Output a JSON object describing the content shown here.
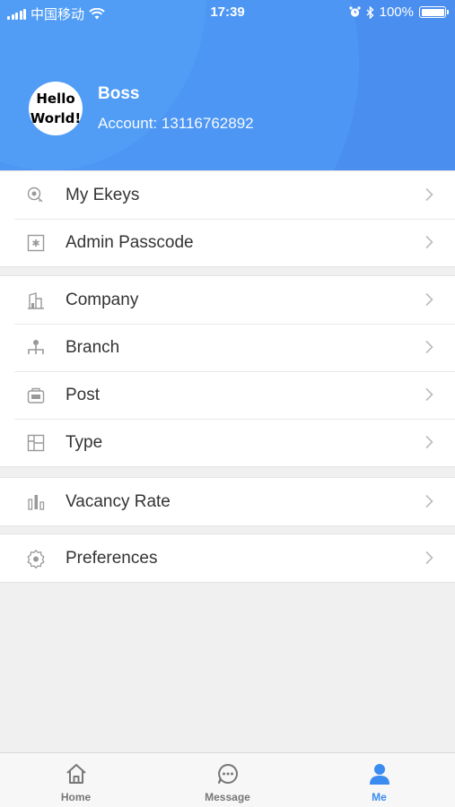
{
  "status_bar": {
    "carrier": "中国移动",
    "time": "17:39",
    "battery": "100%"
  },
  "profile": {
    "avatar_line1": "Hello",
    "avatar_line2": "World!",
    "name": "Boss",
    "account": "Account: 13116762892"
  },
  "menu_groups": [
    {
      "items": [
        {
          "label": "My Ekeys",
          "icon": "key-icon"
        },
        {
          "label": "Admin Passcode",
          "icon": "passcode-icon"
        }
      ]
    },
    {
      "items": [
        {
          "label": "Company",
          "icon": "building-icon"
        },
        {
          "label": "Branch",
          "icon": "org-icon"
        },
        {
          "label": "Post",
          "icon": "badge-icon"
        },
        {
          "label": "Type",
          "icon": "grid-icon"
        }
      ]
    },
    {
      "items": [
        {
          "label": "Vacancy Rate",
          "icon": "bar-chart-icon"
        }
      ]
    },
    {
      "items": [
        {
          "label": "Preferences",
          "icon": "gear-icon"
        }
      ]
    }
  ],
  "tab_bar": {
    "home": "Home",
    "message": "Message",
    "me": "Me"
  },
  "colors": {
    "header": "#4a8ff0",
    "accent": "#3a8cf0"
  }
}
